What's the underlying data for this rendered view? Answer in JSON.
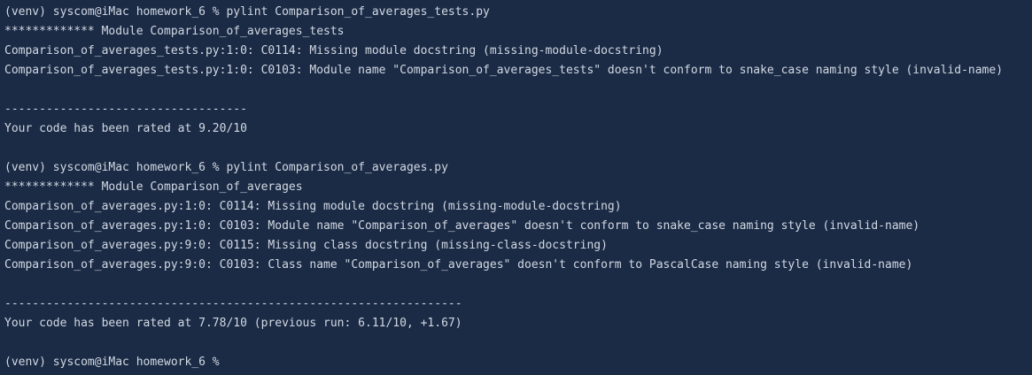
{
  "terminal": {
    "lines": [
      "(venv) syscom@iMac homework_6 % pylint Comparison_of_averages_tests.py",
      "************* Module Comparison_of_averages_tests",
      "Comparison_of_averages_tests.py:1:0: C0114: Missing module docstring (missing-module-docstring)",
      "Comparison_of_averages_tests.py:1:0: C0103: Module name \"Comparison_of_averages_tests\" doesn't conform to snake_case naming style (invalid-name)",
      "",
      "-----------------------------------",
      "Your code has been rated at 9.20/10",
      "",
      "(venv) syscom@iMac homework_6 % pylint Comparison_of_averages.py",
      "************* Module Comparison_of_averages",
      "Comparison_of_averages.py:1:0: C0114: Missing module docstring (missing-module-docstring)",
      "Comparison_of_averages.py:1:0: C0103: Module name \"Comparison_of_averages\" doesn't conform to snake_case naming style (invalid-name)",
      "Comparison_of_averages.py:9:0: C0115: Missing class docstring (missing-class-docstring)",
      "Comparison_of_averages.py:9:0: C0103: Class name \"Comparison_of_averages\" doesn't conform to PascalCase naming style (invalid-name)",
      "",
      "------------------------------------------------------------------",
      "Your code has been rated at 7.78/10 (previous run: 6.11/10, +1.67)",
      "",
      "(venv) syscom@iMac homework_6 % "
    ]
  },
  "colors": {
    "background": "#1b2b45",
    "text": "#d2d8e3"
  }
}
